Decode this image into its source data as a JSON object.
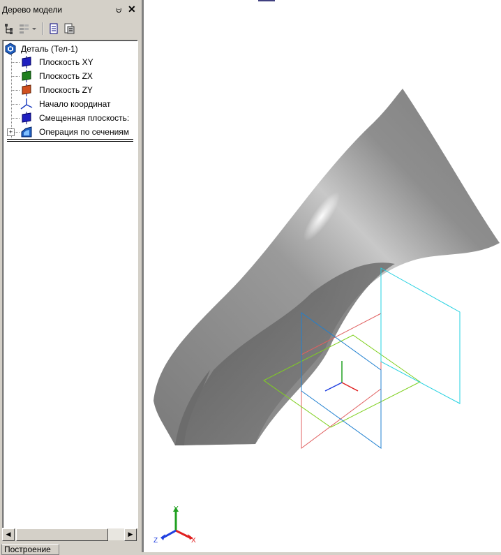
{
  "panel": {
    "title": "Дерево модели",
    "pin_glyph": "⩁",
    "close_glyph": "✕"
  },
  "toolbar": {
    "buttons": [
      "tree-structure-icon",
      "filter-icon",
      "dropdown-arrow-icon",
      "document-icon",
      "properties-icon"
    ]
  },
  "tree": {
    "root": {
      "label": "Деталь (Тел-1)",
      "icon": "part-icon"
    },
    "items": [
      {
        "label": "Плоскость XY",
        "icon": "plane-xy-icon",
        "color": "#2020c0"
      },
      {
        "label": "Плоскость ZX",
        "icon": "plane-zx-icon",
        "color": "#208020"
      },
      {
        "label": "Плоскость ZY",
        "icon": "plane-zy-icon",
        "color": "#c04020"
      },
      {
        "label": "Начало координат",
        "icon": "origin-icon",
        "color": "#2040c0"
      },
      {
        "label": "Смещенная плоскость:",
        "icon": "offset-plane-icon",
        "color": "#2020c0"
      },
      {
        "label": "Операция по сечениям",
        "icon": "loft-operation-icon",
        "color": "#2060c0"
      }
    ],
    "expander": "+"
  },
  "scrollbar": {
    "left_arrow": "◀",
    "right_arrow": "▶"
  },
  "bottom_tab": {
    "label": "Построение"
  },
  "triad": {
    "x": "X",
    "y": "Y",
    "z": "Z"
  },
  "colors": {
    "plane_xy": "#e06060",
    "plane_zx": "#80d020",
    "plane_zy": "#2080d0",
    "plane_offset": "#20d0e0",
    "axis_x": "#e02020",
    "axis_y": "#20a020",
    "axis_z": "#2040e0"
  }
}
